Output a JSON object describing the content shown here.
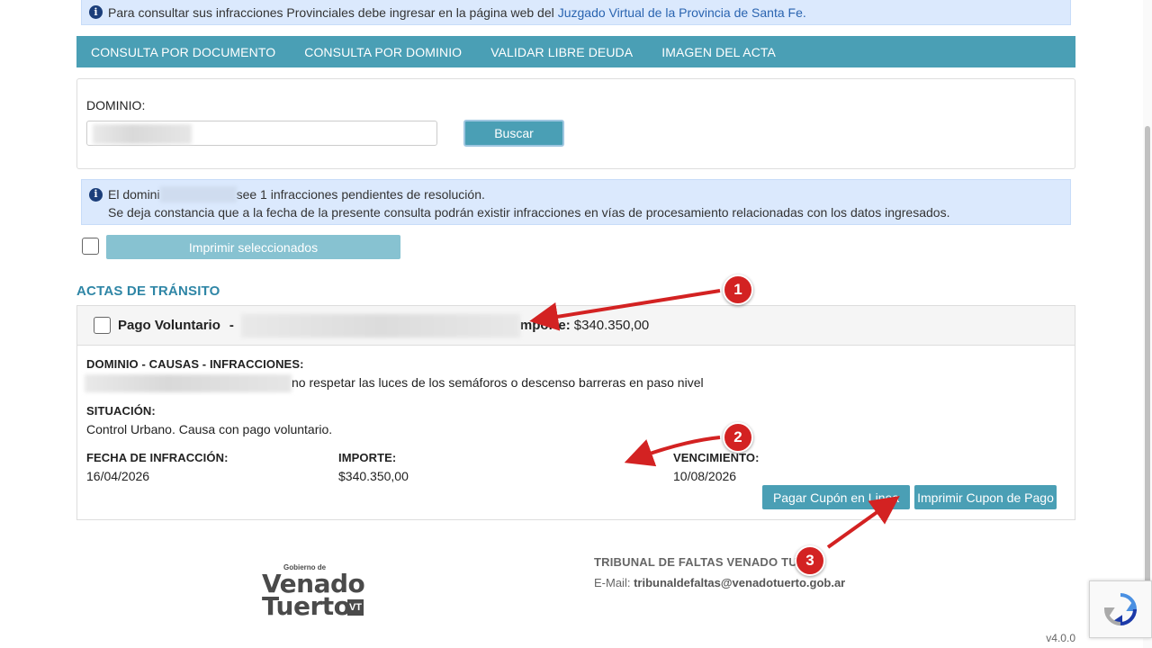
{
  "banner_top": {
    "text": "Para consultar sus infracciones Provinciales debe ingresar en la página web del",
    "link": "Juzgado Virtual de la Provincia de Santa Fe."
  },
  "nav": {
    "items": [
      "CONSULTA POR DOCUMENTO",
      "CONSULTA POR DOMINIO",
      "VALIDAR LIBRE DEUDA",
      "IMAGEN DEL ACTA"
    ]
  },
  "search": {
    "label": "DOMINIO:",
    "value": "",
    "button": "Buscar"
  },
  "result_info": {
    "line1_prefix": "El domini",
    "line1_suffix": "see 1 infracciones pendientes de resolución.",
    "line2": "Se deja constancia que a la fecha de la presente consulta podrán existir infracciones en vías de procesamiento relacionadas con los datos ingresados."
  },
  "print_selected": "Imprimir seleccionados",
  "section_title": "ACTAS DE TRÁNSITO",
  "acta": {
    "header_title": "Pago Voluntario",
    "header_sep": "-",
    "header_importe_label": "mporte:",
    "header_importe_value": "$340.350,00",
    "dominio_label": "DOMINIO - CAUSAS - INFRACCIONES:",
    "dominio_value": "no respetar las luces de los semáforos o descenso barreras en paso nivel",
    "situacion_label": "SITUACIÓN:",
    "situacion_value": "Control Urbano. Causa con pago voluntario.",
    "fecha_label": "FECHA DE INFRACCIÓN:",
    "fecha_value": "16/04/2026",
    "importe_label": "IMPORTE:",
    "importe_value": "$340.350,00",
    "vencimiento_label": "VENCIMIENTO:",
    "vencimiento_value": "10/08/2026",
    "btn_pagar": "Pagar Cupón en Linea",
    "btn_imprimir": "Imprimir Cupon de Pago"
  },
  "footer": {
    "title": "TRIBUNAL DE FALTAS VENADO TUER",
    "email_label": "E-Mail:",
    "email": "tribunaldefaltas@venadotuerto.gob.ar",
    "logo_small": "Gobierno de",
    "logo_line1": "Venado",
    "logo_line2": "Tuerto",
    "logo_mark": "VT"
  },
  "version": "v4.0.0",
  "annotations": [
    "1",
    "2",
    "3"
  ],
  "colors": {
    "accent": "#4a9fb5",
    "info_bg": "#dbe9fd",
    "section_title": "#2f86a6",
    "annotation": "#d32222"
  }
}
